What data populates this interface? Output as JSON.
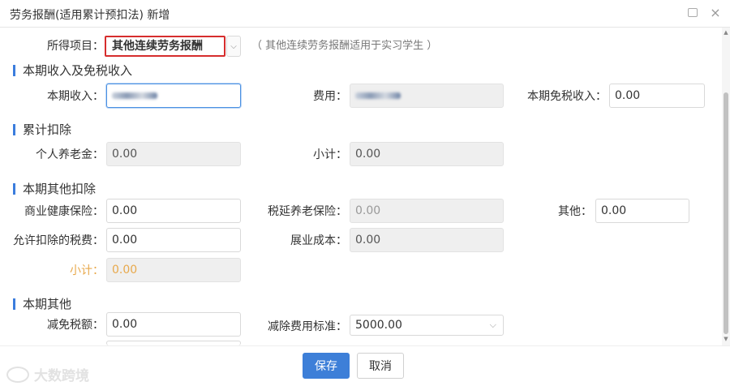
{
  "window": {
    "title": "劳务报酬(适用累计预扣法) 新增",
    "max_icon": "maximize-icon",
    "close_glyph": "×"
  },
  "income_type": {
    "label": "所得项目：",
    "value": "其他连续劳务报酬",
    "hint": "（ 其他连续劳务报酬适用于实习学生 ）"
  },
  "section_income": {
    "title": "本期收入及免税收入",
    "income_label": "本期收入：",
    "fee_label": "费用：",
    "tax_free_label": "本期免税收入：",
    "tax_free_value": "0.00"
  },
  "section_cumulative": {
    "title": "累计扣除",
    "pension_label": "个人养老金：",
    "pension_value": "0.00",
    "subtotal_label": "小计：",
    "subtotal_value": "0.00"
  },
  "section_other_deduction": {
    "title": "本期其他扣除",
    "health_label": "商业健康保险：",
    "health_value": "0.00",
    "deferred_pension_label": "税延养老保险：",
    "deferred_pension_value": "0.00",
    "other_label": "其他：",
    "other_value": "0.00",
    "allowed_tax_label": "允许扣除的税费：",
    "allowed_tax_value": "0.00",
    "exhibition_label": "展业成本：",
    "exhibition_value": "0.00",
    "subtotal_label": "小计：",
    "subtotal_value": "0.00"
  },
  "section_other": {
    "title": "本期其他",
    "relief_label": "减免税额：",
    "relief_value": "0.00",
    "standard_label": "减除费用标准：",
    "standard_value": "5000.00"
  },
  "footer": {
    "save_label": "保存",
    "cancel_label": "取消",
    "watermark_text": "大数跨境"
  },
  "colors": {
    "primary": "#3d7fd8",
    "highlight_border": "#d62d2d",
    "section_bar": "#3b7ddd",
    "subtotal_text": "#e8a94c"
  }
}
